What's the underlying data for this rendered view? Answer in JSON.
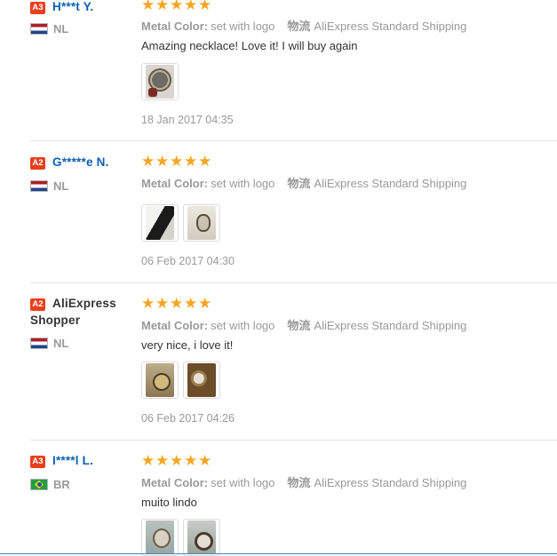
{
  "prop_label": "Metal Color:",
  "prop_value": "set with logo",
  "ship_label": "物流",
  "ship_value": "AliExpress Standard Shipping",
  "star_glyph": "★",
  "colors": {
    "star": "#f5a623",
    "badge": "#e8401c",
    "username": "#0b5fb0",
    "divider": "#e6e6e6",
    "bottom_border": "#3a8ac9"
  },
  "reviews": [
    {
      "badge": "A3",
      "user_line1": "H***t Y.",
      "user_line2": "",
      "country": "NL",
      "rating": 5,
      "feedback": "Amazing necklace! Love it! I will buy again",
      "photos": 1,
      "date": "18 Jan 2017 04:35"
    },
    {
      "badge": "A2",
      "user_line1": "G*****e N.",
      "user_line2": "",
      "country": "NL",
      "rating": 5,
      "feedback": "",
      "photos": 2,
      "date": "06 Feb 2017 04:30"
    },
    {
      "badge": "A2",
      "user_line1": "AliExpress",
      "user_line2": "Shopper",
      "country": "NL",
      "rating": 5,
      "feedback": "very nice, i love it!",
      "photos": 2,
      "date": "06 Feb 2017 04:26"
    },
    {
      "badge": "A3",
      "user_line1": "I****l L.",
      "user_line2": "",
      "country": "BR",
      "rating": 5,
      "feedback": "muito lindo",
      "photos": 2,
      "date": ""
    }
  ]
}
